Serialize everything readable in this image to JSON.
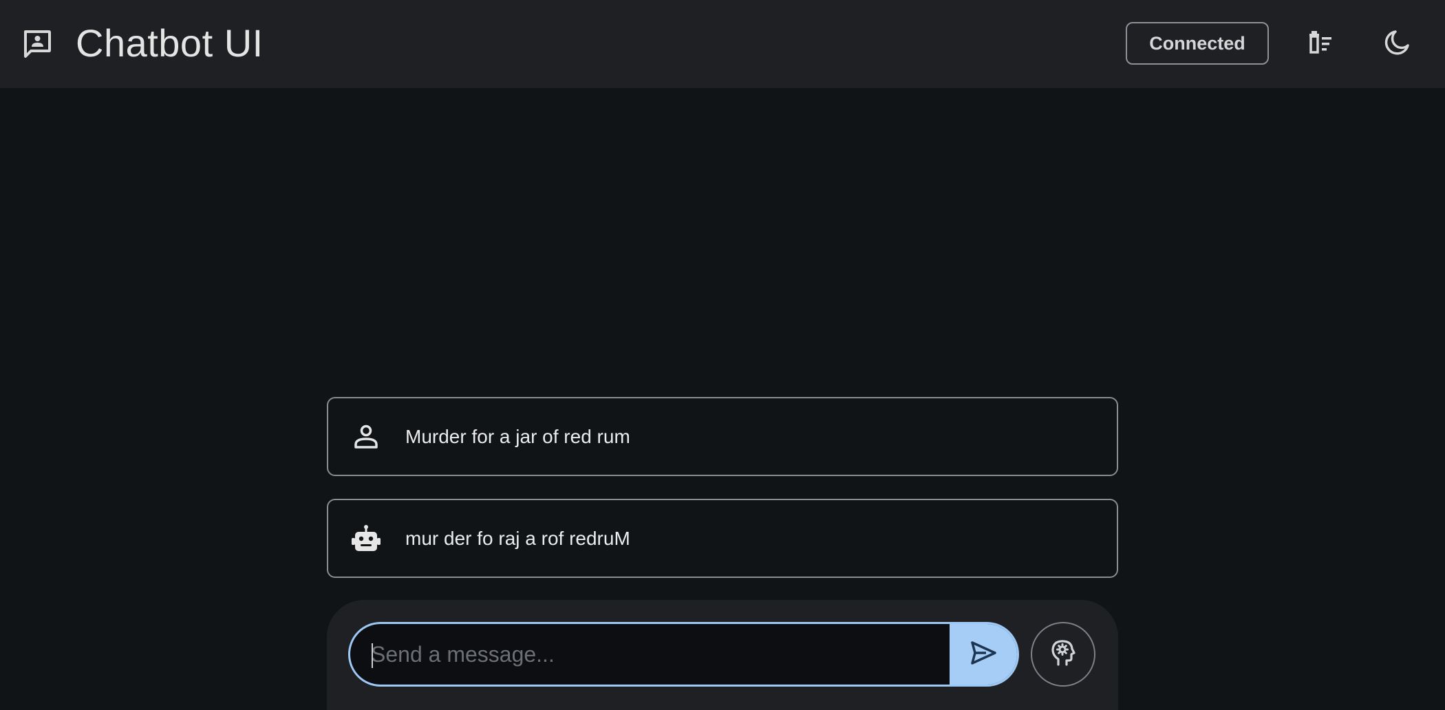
{
  "header": {
    "app_icon": "chat-bubble-person-icon",
    "title": "Chatbot UI",
    "status_label": "Connected",
    "clear_icon": "clear-history-icon",
    "theme_icon": "moon-icon"
  },
  "messages": [
    {
      "role": "user",
      "icon": "person-icon",
      "text": "Murder for a jar of red rum"
    },
    {
      "role": "bot",
      "icon": "robot-icon",
      "text": "mur der fo raj a rof redruM"
    }
  ],
  "composer": {
    "placeholder": "Send a message...",
    "value": "",
    "send_icon": "send-icon",
    "persona_icon": "psychology-head-icon"
  },
  "colors": {
    "background": "#111417",
    "header": "#1e2024",
    "accent": "#a5cdf6",
    "border": "#8a8d91"
  }
}
